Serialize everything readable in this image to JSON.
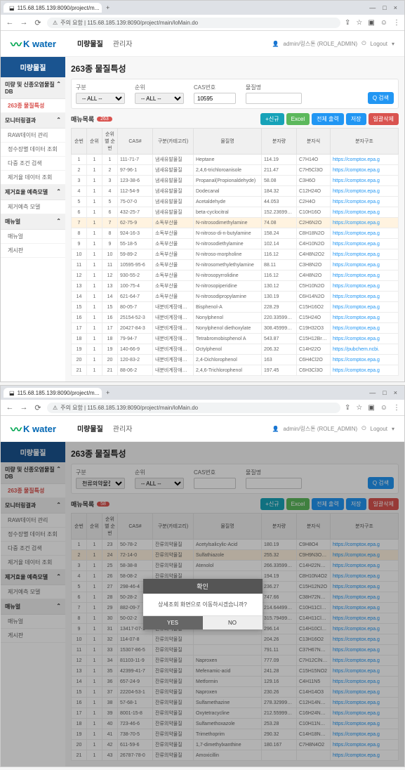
{
  "browser": {
    "tab_title": "115.68.185.139:8090/project/m...",
    "url": "주의 요함 | 115.68.185.139:8090/project/main/loMain.do",
    "win_min": "—",
    "win_max": "□",
    "win_close": "×"
  },
  "header": {
    "logo": "K water",
    "top_tabs": [
      "미량물질",
      "관리자"
    ],
    "user": "admin/링스톤 (ROLE_ADMIN)",
    "logout": "Logout"
  },
  "sidebar": {
    "title": "미량물질",
    "groups": [
      {
        "label": "미량 및 신종오염물질DB",
        "items": [
          {
            "label": "263종 물질특성",
            "active": true
          }
        ]
      },
      {
        "label": "모니터링결과",
        "items": [
          {
            "label": "RAW데이터 관리"
          },
          {
            "label": "정수장별 데이터 조회"
          },
          {
            "label": "다중 조건 검색"
          },
          {
            "label": "제거율 데이터 조회"
          }
        ]
      },
      {
        "label": "제거효율 예측모델",
        "items": [
          {
            "label": "제거예측 모델"
          }
        ]
      },
      {
        "label": "매뉴얼",
        "items": [
          {
            "label": "매뉴얼"
          },
          {
            "label": "게시판"
          }
        ]
      }
    ]
  },
  "filter": {
    "page_title": "263종 물질특성",
    "labels": {
      "gubun": "구분",
      "order": "순위",
      "cas": "CAS번호",
      "name": "물질명"
    },
    "all": "-- ALL --",
    "cas_value_s1": "10595",
    "search_btn": "Q 검색"
  },
  "list": {
    "label": "매뉴목록",
    "count_s1": "263",
    "count_s2": "58"
  },
  "buttons": {
    "add": "+신규",
    "excel": "Excel",
    "print": "전체 출력",
    "save": "저장",
    "delete": "일괄삭제"
  },
  "columns": [
    "순번",
    "순위",
    "순위별 순번",
    "CAS#",
    "구분(카테고리)",
    "물질명",
    "분자량",
    "분자식",
    "분자구조"
  ],
  "filter_s2_gubun": "천류의약물질",
  "rows_s1": [
    {
      "n": "1",
      "r": "1",
      "rs": "1",
      "cas": "111-71-7",
      "cat": "냄새유발물질",
      "name": "Heptane",
      "mw": "114.19",
      "mf": "C7H14O",
      "url": "https://comptox.epa.g"
    },
    {
      "n": "2",
      "r": "1",
      "rs": "2",
      "cas": "97-96-1",
      "cat": "냄새유발물질",
      "name": "2,4,6-trichloroanisole",
      "mw": "211.47",
      "mf": "C7H5Cl3O",
      "url": "https://comptox.epa.g"
    },
    {
      "n": "3",
      "r": "1",
      "rs": "3",
      "cas": "123-38-6",
      "cat": "냄새유발물질",
      "name": "Propanal(Propionaldehyde)",
      "mw": "58.08",
      "mf": "C3H6O",
      "url": "https://comptox.epa.g"
    },
    {
      "n": "4",
      "r": "1",
      "rs": "4",
      "cas": "112-54-9",
      "cat": "냄새유발물질",
      "name": "Dodecanal",
      "mw": "184.32",
      "mf": "C12H24O",
      "url": "https://comptox.epa.g"
    },
    {
      "n": "5",
      "r": "1",
      "rs": "5",
      "cas": "75-07-0",
      "cat": "냄새유발물질",
      "name": "Acetaldehyde",
      "mw": "44.053",
      "mf": "C2H4O",
      "url": "https://comptox.epa.g"
    },
    {
      "n": "6",
      "r": "1",
      "rs": "6",
      "cas": "432-25-7",
      "cat": "냄새유발물질",
      "name": "beta-cyclocitral",
      "mw": "152.23699999999999",
      "mf": "C10H16O",
      "url": "https://comptox.epa.g"
    },
    {
      "n": "7",
      "r": "1",
      "rs": "7",
      "cas": "62-75-9",
      "cat": "소독부산물",
      "name": "N-nitrosodimethylamine",
      "mw": "74.08",
      "mf": "C2H6N2O",
      "url": "https://comptox.epa.g",
      "hl": true
    },
    {
      "n": "8",
      "r": "1",
      "rs": "8",
      "cas": "924-16-3",
      "cat": "소독부산물",
      "name": "N-nitroso-di-n-butylamine",
      "mw": "158.24",
      "mf": "C8H18N2O",
      "url": "https://comptox.epa.g"
    },
    {
      "n": "9",
      "r": "1",
      "rs": "9",
      "cas": "55-18-5",
      "cat": "소독부산물",
      "name": "N-nitrosodiethylamine",
      "mw": "102.14",
      "mf": "C4H10N2O",
      "url": "https://comptox.epa.g"
    },
    {
      "n": "10",
      "r": "1",
      "rs": "10",
      "cas": "59-89-2",
      "cat": "소독부산물",
      "name": "N-nitroso-morpholine",
      "mw": "116.12",
      "mf": "C4H8N2O2",
      "url": "https://comptox.epa.g"
    },
    {
      "n": "11",
      "r": "1",
      "rs": "11",
      "cas": "10595-95-6",
      "cat": "소독부산물",
      "name": "N-nitrosomethylethylamine",
      "mw": "88.11",
      "mf": "C3H8N2O",
      "url": "https://comptox.epa.g"
    },
    {
      "n": "12",
      "r": "1",
      "rs": "12",
      "cas": "930-55-2",
      "cat": "소독부산물",
      "name": "N-nitrosopyrrolidine",
      "mw": "116.12",
      "mf": "C4H8N2O",
      "url": "https://comptox.epa.g"
    },
    {
      "n": "13",
      "r": "1",
      "rs": "13",
      "cas": "100-75-4",
      "cat": "소독부산물",
      "name": "N-nitrosopiperidine",
      "mw": "130.12",
      "mf": "C5H10N2O",
      "url": "https://comptox.epa.g"
    },
    {
      "n": "14",
      "r": "1",
      "rs": "14",
      "cas": "621-64-7",
      "cat": "소독부산물",
      "name": "N-nitrosodipropylamine",
      "mw": "130.19",
      "mf": "C6H14N2O",
      "url": "https://comptox.epa.g"
    },
    {
      "n": "15",
      "r": "1",
      "rs": "15",
      "cas": "80-05-7",
      "cat": "내분비계장애물질",
      "name": "Bisphenol-A",
      "mw": "228.29",
      "mf": "C15H16O2",
      "url": "https://comptox.epa.g"
    },
    {
      "n": "16",
      "r": "1",
      "rs": "16",
      "cas": "25154-52-3",
      "cat": "내분비계장애물질",
      "name": "Nonylphenol",
      "mw": "220.33599999999999999",
      "mf": "C15H24O",
      "url": "https://comptox.epa.g"
    },
    {
      "n": "17",
      "r": "1",
      "rs": "17",
      "cas": "20427-84-3",
      "cat": "내분비계장애물질",
      "name": "Nonylphenol diethoxylate",
      "mw": "308.45999999999999999",
      "mf": "C19H32O3",
      "url": "https://comptox.epa.g"
    },
    {
      "n": "18",
      "r": "1",
      "rs": "18",
      "cas": "79-94-7",
      "cat": "내분비계장애물질",
      "name": "Tetrabromobisphenol A",
      "mw": "543.87",
      "mf": "C15H12Br4O2",
      "url": "https://comptox.epa.g"
    },
    {
      "n": "19",
      "r": "1",
      "rs": "19",
      "cas": "140-66-9",
      "cat": "내분비계장애물질",
      "name": "Octylphenol",
      "mw": "206.32",
      "mf": "C14H22O",
      "url": "https://pubchem.ncbi."
    },
    {
      "n": "20",
      "r": "1",
      "rs": "20",
      "cas": "120-83-2",
      "cat": "내분비계장애물질",
      "name": "2,4-Dichlorophenol",
      "mw": "163",
      "mf": "C6H4Cl2O",
      "url": "https://comptox.epa.g"
    },
    {
      "n": "21",
      "r": "1",
      "rs": "21",
      "cas": "88-06-2",
      "cat": "내분비계장애물질",
      "name": "2,4,6-Trichlorophenol",
      "mw": "197.45",
      "mf": "C6H3Cl3O",
      "url": "https://comptox.epa.g"
    }
  ],
  "rows_s2": [
    {
      "n": "1",
      "r": "1",
      "rs": "23",
      "cas": "50-78-2",
      "cat": "잔류의약물질",
      "name": "Acetylsalicylic-Acid",
      "mw": "180.19",
      "mf": "C9H8O4",
      "url": "https://comptox.epa.g"
    },
    {
      "n": "2",
      "r": "1",
      "rs": "24",
      "cas": "72-14-0",
      "cat": "잔류의약물질",
      "name": "Sulfathiazole",
      "mw": "255.32",
      "mf": "C9H9N3O2S2",
      "url": "https://comptox.epa.g",
      "hl": true
    },
    {
      "n": "3",
      "r": "1",
      "rs": "25",
      "cas": "58-38-8",
      "cat": "잔류의약물질",
      "name": "Atenolol",
      "mw": "266.3359999999999997",
      "mf": "C14H22N2O3",
      "url": "https://comptox.epa.g"
    },
    {
      "n": "4",
      "r": "1",
      "rs": "26",
      "cas": "58-08-2",
      "cat": "잔류의약물질",
      "name": "",
      "mw": "194.19",
      "mf": "C8H10N4O2",
      "url": "https://comptox.epa.g"
    },
    {
      "n": "5",
      "r": "1",
      "rs": "27",
      "cas": "298-46-4",
      "cat": "잔류의약물질",
      "name": "",
      "mw": "236.27",
      "mf": "C15H12N2O",
      "url": "https://comptox.epa.g"
    },
    {
      "n": "6",
      "r": "1",
      "rs": "28",
      "cas": "50-28-2",
      "cat": "잔류의약물질",
      "name": "",
      "mw": "747.66",
      "mf": "C38H72N2O12",
      "url": "https://comptox.epa.g"
    },
    {
      "n": "7",
      "r": "1",
      "rs": "29",
      "cas": "882-09-7",
      "cat": "잔류의약물질",
      "name": "",
      "mw": "214.64499999999999998",
      "mf": "C10H11ClO3",
      "url": "https://comptox.epa.g"
    },
    {
      "n": "8",
      "r": "1",
      "rs": "30",
      "cas": "50-02-2",
      "cat": "잔류의약물질",
      "name": "",
      "mw": "315.79499999999999999",
      "mf": "C14H11Cl2NO2",
      "url": "https://comptox.epa.g"
    },
    {
      "n": "9",
      "r": "1",
      "rs": "31",
      "cas": "13417-07-1",
      "cat": "잔류의약물질",
      "name": "",
      "mw": "296.14",
      "mf": "C14H10Cl2O3",
      "url": "https://comptox.epa.g"
    },
    {
      "n": "10",
      "r": "1",
      "rs": "32",
      "cas": "114-07-8",
      "cat": "잔류의약물질",
      "name": "",
      "mw": "204.26",
      "mf": "C13H16O2",
      "url": "https://comptox.epa.g"
    },
    {
      "n": "11",
      "r": "1",
      "rs": "33",
      "cas": "15307-86-5",
      "cat": "잔류의약물질",
      "name": "",
      "mw": "791.11",
      "mf": "C37H67NO13",
      "url": "https://comptox.epa.g"
    },
    {
      "n": "12",
      "r": "1",
      "rs": "34",
      "cas": "81103-11-9",
      "cat": "잔류의약물질",
      "name": "Naproxen",
      "mw": "777.09",
      "mf": "C7H12ClN3O4S",
      "url": "https://comptox.epa.g"
    },
    {
      "n": "13",
      "r": "1",
      "rs": "35",
      "cas": "42399-41-7",
      "cat": "잔류의약물질",
      "name": "Mefenamic-acid",
      "mw": "241.28",
      "mf": "C15H15NO2",
      "url": "https://comptox.epa.g"
    },
    {
      "n": "14",
      "r": "1",
      "rs": "36",
      "cas": "657-24-9",
      "cat": "잔류의약물질",
      "name": "Metformin",
      "mw": "129.16",
      "mf": "C4H11N5",
      "url": "https://comptox.epa.g"
    },
    {
      "n": "15",
      "r": "1",
      "rs": "37",
      "cas": "22204-53-1",
      "cat": "잔류의약물질",
      "name": "Naproxen",
      "mw": "230.26",
      "mf": "C14H14O3",
      "url": "https://comptox.epa.g"
    },
    {
      "n": "16",
      "r": "1",
      "rs": "38",
      "cas": "57-68-1",
      "cat": "잔류의약물질",
      "name": "Sulfamethazine",
      "mw": "278.32999999999999999",
      "mf": "C12H14N4O2S",
      "url": "https://comptox.epa.g"
    },
    {
      "n": "17",
      "r": "1",
      "rs": "39",
      "cas": "8001-15-8",
      "cat": "잔류의약물질",
      "name": "Oxytetracycline",
      "mw": "212.55999999999999998",
      "mf": "C16H24N2O4",
      "url": "https://comptox.epa.g"
    },
    {
      "n": "18",
      "r": "1",
      "rs": "40",
      "cas": "723-46-6",
      "cat": "잔류의약물질",
      "name": "Sulfamethoxazole",
      "mw": "253.28",
      "mf": "C10H11N3O3S",
      "url": "https://comptox.epa.g"
    },
    {
      "n": "19",
      "r": "1",
      "rs": "41",
      "cas": "738-70-5",
      "cat": "잔류의약물질",
      "name": "Trimethoprim",
      "mw": "290.32",
      "mf": "C14H18N4O3",
      "url": "https://comptox.epa.g"
    },
    {
      "n": "20",
      "r": "1",
      "rs": "42",
      "cas": "611-59-6",
      "cat": "잔류의약물질",
      "name": "1,7-dimethylxanthine",
      "mw": "180.167",
      "mf": "C7H8N4O2",
      "url": "https://comptox.epa.g"
    },
    {
      "n": "21",
      "r": "1",
      "rs": "43",
      "cas": "26787-78-0",
      "cat": "잔류의약물질",
      "name": "Amoxicillin",
      "mw": "",
      "mf": "",
      "url": "https://comptox.epa.g"
    }
  ],
  "modal": {
    "title": "확인",
    "message": "상세조회 화면으로 이동하시겠습니까?",
    "yes": "YES",
    "no": "NO"
  }
}
